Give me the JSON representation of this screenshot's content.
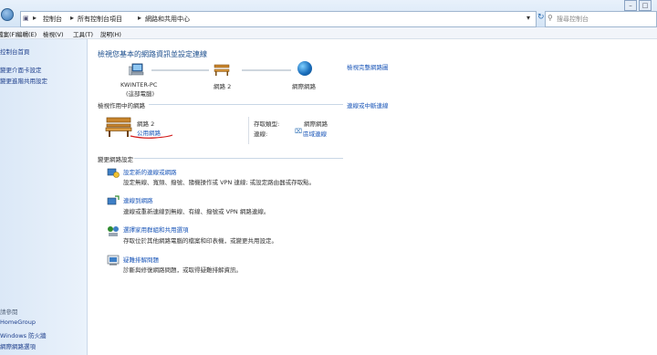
{
  "address_bar": {
    "crumbs": [
      "控制台",
      "所有控制台項目",
      "網路和共用中心"
    ],
    "search_placeholder": "搜尋控制台"
  },
  "menu": {
    "file": "檔案(F)",
    "edit": "編輯(E)",
    "view": "檢視(V)",
    "tools": "工具(T)",
    "help": "說明(H)"
  },
  "sidebar": {
    "links": [
      "控制台首頁",
      "變更介面卡設定",
      "變更進階共用設定"
    ],
    "see_also_title": "請參閱",
    "see_also": [
      "HomeGroup",
      "Windows 防火牆",
      "網際網路選項"
    ]
  },
  "main": {
    "title": "檢視您基本的網路資訊並設定連線",
    "view_full_map": "檢視完整網路圖",
    "map": {
      "pc_name": "KWINTER-PC",
      "pc_sub": "(這部電腦)",
      "network": "網路  2",
      "internet": "網際網路"
    },
    "active_networks": {
      "title": "檢視作用中的網路",
      "connect_disconnect": "連線或中斷連線",
      "name": "網路  2",
      "type_link": "公用網路",
      "access_type_label": "存取類型:",
      "access_type_value": "網際網路",
      "connections_label": "連線:",
      "connections_value": "區域連線"
    },
    "change_settings": {
      "title": "變更網路設定",
      "tasks": [
        {
          "title": "設定新的連線或網路",
          "desc": "設定無線、寬頻、撥號、隨機操作或 VPN 連線; 或設定路由器或存取點。"
        },
        {
          "title": "連線到網路",
          "desc": "連線或重新連線到無線、有線、撥號或 VPN 網路連線。"
        },
        {
          "title": "選擇家用群組和共用選項",
          "desc": "存取位於其他網路電腦的檔案和印表機，或變更共用設定。"
        },
        {
          "title": "疑難排解問題",
          "desc": "診斷與修復網路問題，或取得疑難排解資訊。"
        }
      ]
    }
  },
  "colors": {
    "link": "#1a56b8",
    "title": "#1d4f8e",
    "sidebar_bg": "#dbe8f7",
    "underline_annotation": "#d21a1a"
  }
}
